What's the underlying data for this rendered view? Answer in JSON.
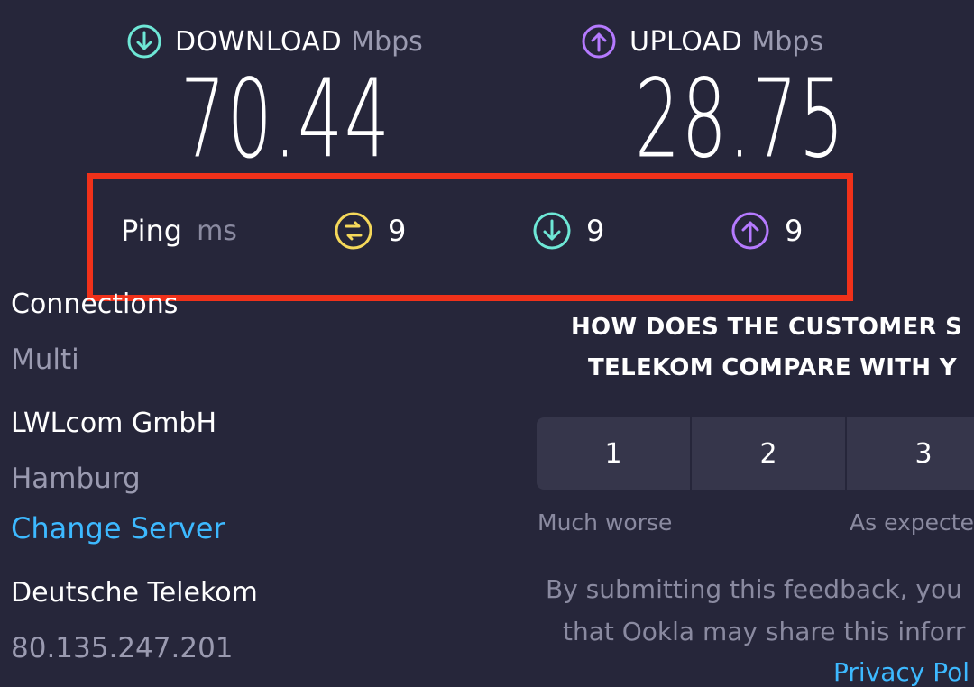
{
  "download": {
    "label": "DOWNLOAD",
    "unit": "Mbps",
    "value": "70.44",
    "icon": "download-arrow-circle-icon",
    "color": "#6ee7d6"
  },
  "upload": {
    "label": "UPLOAD",
    "unit": "Mbps",
    "value": "28.75",
    "icon": "upload-arrow-circle-icon",
    "color": "#b57aff"
  },
  "ping": {
    "label": "Ping",
    "unit": "ms",
    "idle": "9",
    "download": "9",
    "upload": "9",
    "idle_color": "#f5d85a",
    "highlight_color": "#f0311a"
  },
  "connections": {
    "title": "Connections",
    "value": "Multi"
  },
  "server": {
    "name": "LWLcom GmbH",
    "location": "Hamburg",
    "change_label": "Change Server"
  },
  "provider": {
    "name": "Deutsche Telekom",
    "ip": "80.135.247.201"
  },
  "feedback": {
    "question_line1": "HOW DOES THE CUSTOMER S",
    "question_line2": "TELEKOM COMPARE WITH Y",
    "ratings": [
      "1",
      "2",
      "3"
    ],
    "low_label": "Much worse",
    "mid_label": "As expecte",
    "disclaimer_line1": "By submitting this feedback, you",
    "disclaimer_line2": "that Ookla may share this inforr",
    "privacy_link": "Privacy Pol"
  },
  "accent_link_color": "#3db9ff"
}
